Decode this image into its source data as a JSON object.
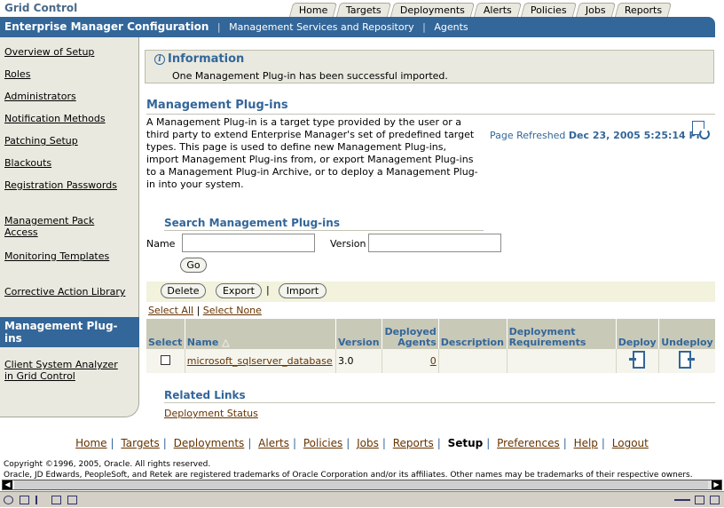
{
  "app": {
    "brand": "Grid Control",
    "tabs": [
      "Home",
      "Targets",
      "Deployments",
      "Alerts",
      "Policies",
      "Jobs",
      "Reports"
    ]
  },
  "subnav": {
    "active": "Enterprise Manager Configuration",
    "links": [
      "Management Services and Repository",
      "Agents"
    ]
  },
  "sidebar": {
    "items": [
      "Overview of Setup",
      "Roles",
      "Administrators",
      "Notification Methods",
      "Patching Setup",
      "Blackouts",
      "Registration Passwords",
      "Management Pack Access",
      "Monitoring Templates",
      "Corrective Action Library",
      "Management Plug-ins",
      "Client System Analyzer in Grid Control"
    ]
  },
  "info": {
    "title": "Information",
    "message": "One Management Plug-in has been successful imported."
  },
  "page": {
    "title": "Management Plug-ins",
    "description": "A Management Plug-in is a target type provided by the user or a third party to extend Enterprise Manager's set of predefined target types. This page is used to define new Management Plug-ins, import Management Plug-ins from, or export Management Plug-ins to a Management Plug-in Archive, or to deploy a Management Plug-in into your system.",
    "refreshed_label": "Page Refreshed",
    "refreshed_value": "Dec 23, 2005 5:25:14 PM"
  },
  "search": {
    "title": "Search Management Plug-ins",
    "name_label": "Name",
    "version_label": "Version",
    "name_value": "",
    "version_value": "",
    "go": "Go"
  },
  "actions": {
    "delete": "Delete",
    "export": "Export",
    "import": "Import",
    "select_all": "Select All",
    "select_none": "Select None"
  },
  "table": {
    "headers": {
      "select": "Select",
      "name": "Name",
      "version": "Version",
      "deployed_agents": "Deployed Agents",
      "description": "Description",
      "requirements": "Deployment Requirements",
      "deploy": "Deploy",
      "undeploy": "Undeploy"
    },
    "rows": [
      {
        "name": "microsoft_sqlserver_database",
        "version": "3.0",
        "deployed_agents": "0",
        "description": "",
        "requirements": ""
      }
    ]
  },
  "related": {
    "title": "Related Links",
    "links": [
      "Deployment Status"
    ]
  },
  "footer": {
    "links": [
      "Home",
      "Targets",
      "Deployments",
      "Alerts",
      "Policies",
      "Jobs",
      "Reports",
      "Setup",
      "Preferences",
      "Help",
      "Logout"
    ],
    "current": "Setup",
    "copyright": "Copyright ©1996, 2005, Oracle. All rights reserved.",
    "legal": "Oracle, JD Edwards, PeopleSoft, and Retek are registered trademarks of Oracle Corporation and/or its affiliates. Other names may be trademarks of their respective owners."
  },
  "colors": {
    "brand_blue": "#336699",
    "panel_beige": "#e9e9e0",
    "link_brown": "#663300"
  }
}
